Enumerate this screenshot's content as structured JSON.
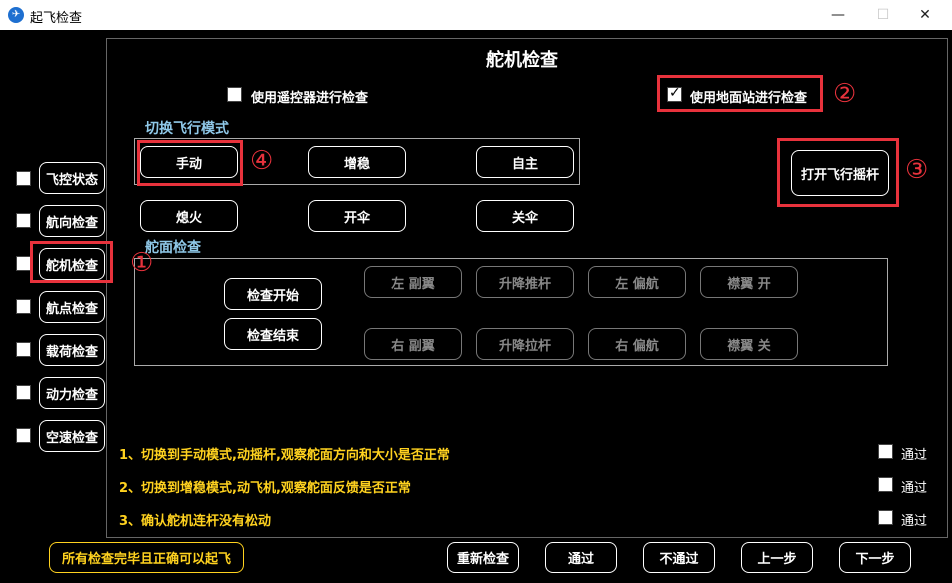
{
  "window": {
    "title": "起飞检查",
    "app_icon": "app-icon",
    "minimize": "—",
    "maximize": "☐",
    "close": "✕"
  },
  "sidebar": {
    "items": [
      {
        "label": "飞控状态",
        "checked": false
      },
      {
        "label": "航向检查",
        "checked": false
      },
      {
        "label": "舵机检查",
        "checked": false
      },
      {
        "label": "航点检查",
        "checked": false
      },
      {
        "label": "载荷检查",
        "checked": false
      },
      {
        "label": "动力检查",
        "checked": false
      },
      {
        "label": "空速检查",
        "checked": false
      }
    ]
  },
  "main": {
    "title": "舵机检查",
    "remote_check_label": "使用遥控器进行检查",
    "ground_station_label": "使用地面站进行检查",
    "flight_mode_group": "切换飞行模式",
    "flight_modes": [
      "手动",
      "增稳",
      "自主"
    ],
    "actions": [
      "熄火",
      "开伞",
      "关伞"
    ],
    "open_joystick": "打开飞行摇杆",
    "surface_group": "舵面检查",
    "check_start": "检查开始",
    "check_end": "检查结束",
    "surface_row1": [
      "左 副翼",
      "升降推杆",
      "左 偏航",
      "襟翼 开"
    ],
    "surface_row2": [
      "右 副翼",
      "升降拉杆",
      "右 偏航",
      "襟翼 关"
    ],
    "instructions": [
      "1、切换到手动模式,动摇杆,观察舵面方向和大小是否正常",
      "2、切换到增稳模式,动飞机,观察舵面反馈是否正常",
      "3、确认舵机连杆没有松动"
    ],
    "pass_label": "通过"
  },
  "annotations": [
    "①",
    "②",
    "③",
    "④"
  ],
  "footer": {
    "all_done": "所有检查完毕且正确可以起飞",
    "recheck": "重新检查",
    "pass": "通过",
    "fail": "不通过",
    "prev": "上一步",
    "next": "下一步"
  },
  "colors": {
    "annotation_red": "#e8323c",
    "instruction_yellow": "#ffd21f",
    "group_label_blue": "#8fc8e8"
  }
}
